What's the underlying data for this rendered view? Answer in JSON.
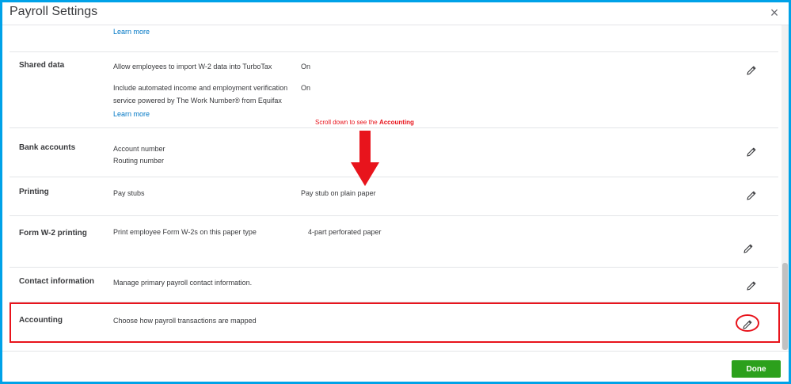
{
  "window": {
    "title": "Payroll Settings",
    "close_glyph": "×"
  },
  "top_partial": {
    "learn_more": "Learn more"
  },
  "sections": {
    "shared_data": {
      "label": "Shared data",
      "desc1": "Allow employees to import W-2 data into TurboTax",
      "val1": "On",
      "desc2_line1": "Include automated income and employment verification",
      "desc2_line2": "service powered by The Work Number® from Equifax",
      "val2": "On",
      "learn_more": "Learn more"
    },
    "bank_accounts": {
      "label": "Bank accounts",
      "line1": "Account number",
      "line2": "Routing number"
    },
    "printing": {
      "label": "Printing",
      "desc": "Pay stubs",
      "val": "Pay stub on plain paper"
    },
    "w2_printing": {
      "label": "Form W-2 printing",
      "desc": "Print employee Form W-2s on this paper type",
      "val": "4-part perforated paper"
    },
    "contact": {
      "label": "Contact information",
      "desc": "Manage primary payroll contact information."
    },
    "accounting": {
      "label": "Accounting",
      "desc": "Choose how payroll transactions are mapped"
    }
  },
  "annotation": {
    "text_prefix": "Scroll down to see the ",
    "text_bold": "Accounting",
    "color": "#e8141c"
  },
  "footer": {
    "done_label": "Done"
  },
  "colors": {
    "accent_green": "#2ca01c",
    "link_blue": "#0077c5",
    "frame_blue": "#00a2e8"
  },
  "icons": {
    "edit": "pencil-icon",
    "close": "close-icon",
    "arrow": "arrow-down-icon"
  }
}
